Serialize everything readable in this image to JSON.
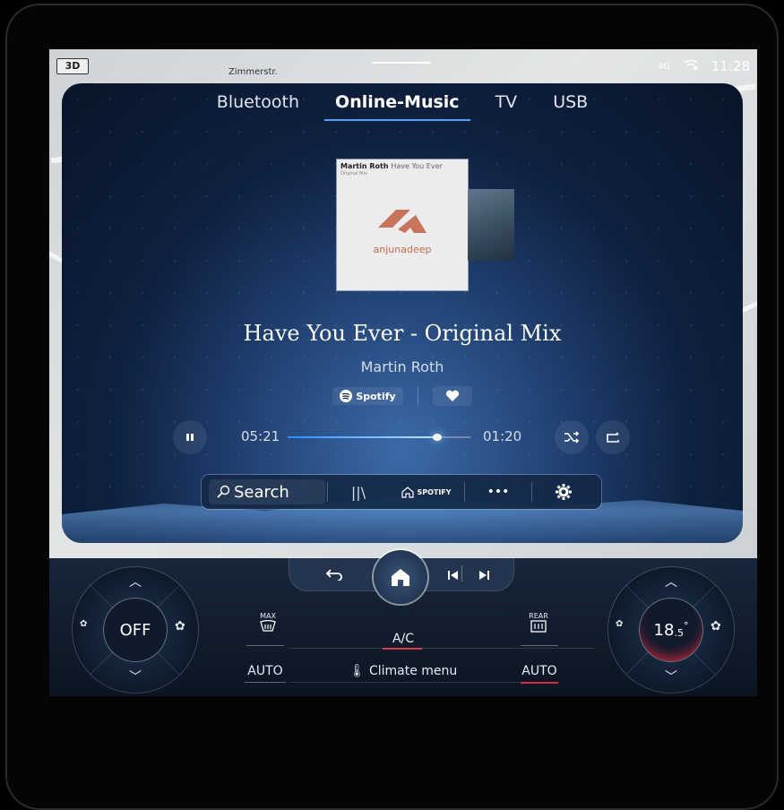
{
  "status_bar": {
    "view_mode": "3D",
    "street_label": "Zimmerstr.",
    "signal": "4G",
    "time": "11:28"
  },
  "tabs": [
    {
      "label": "Bluetooth",
      "active": false
    },
    {
      "label": "Online-Music",
      "active": true
    },
    {
      "label": "TV",
      "active": false
    },
    {
      "label": "USB",
      "active": false
    }
  ],
  "album": {
    "cover_artist": "Martin Roth",
    "cover_title": "Have You Ever",
    "cover_sub": "Original Mix",
    "label": "anjunadeep"
  },
  "now_playing": {
    "title": "Have You Ever - Original Mix",
    "artist": "Martin Roth",
    "source": "Spotify",
    "elapsed": "05:21",
    "remaining": "01:20",
    "progress": 0.82
  },
  "toolbar": {
    "search_label": "Search",
    "library_label": "||\\",
    "spotify_label": "SPOTIFY",
    "more_label": "•••"
  },
  "climate": {
    "left_zone": "OFF",
    "right_temp": "18",
    "right_temp_decimal": ".5",
    "right_temp_unit": "°",
    "max_label": "MAX",
    "rear_label": "REAR",
    "ac_label": "A/C",
    "auto_left": "AUTO",
    "auto_right": "AUTO",
    "climate_menu": "Climate menu"
  },
  "colors": {
    "accent": "#4aa3ff",
    "active_red": "#e0283c"
  }
}
